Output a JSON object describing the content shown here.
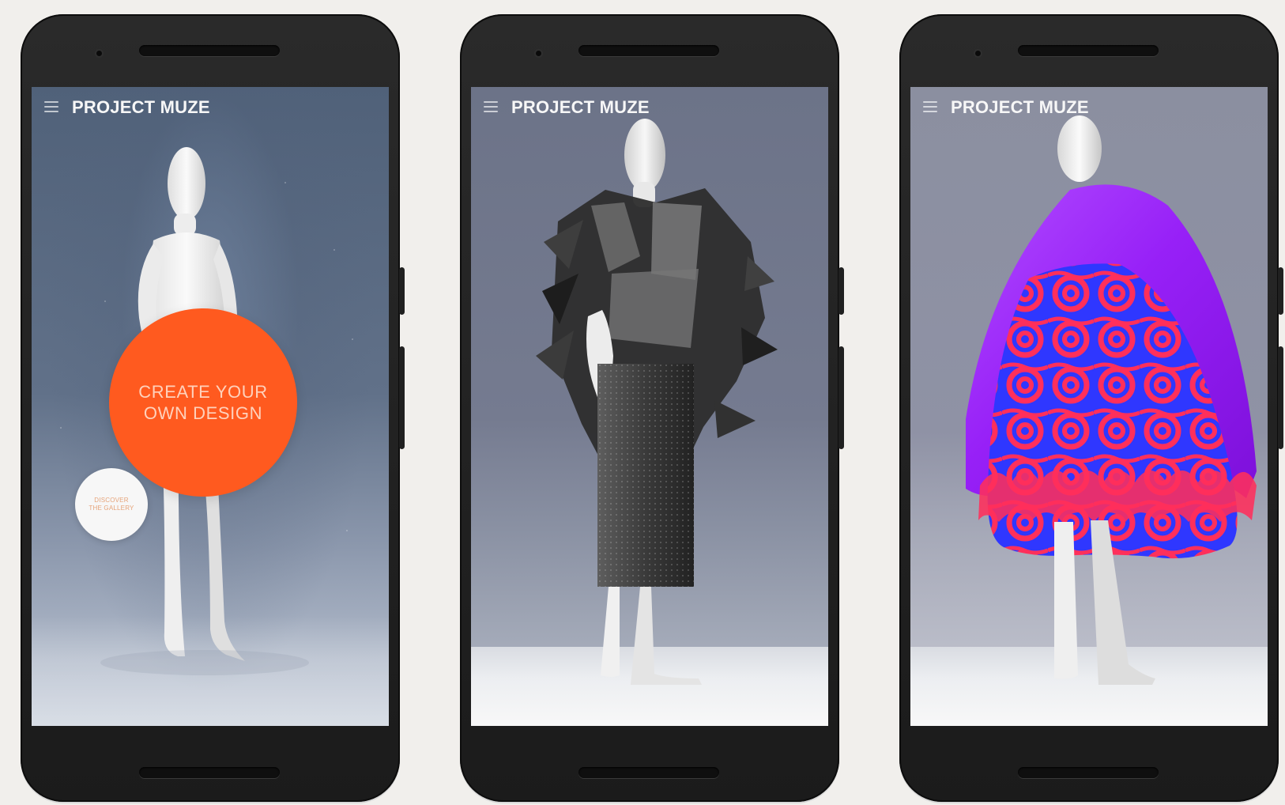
{
  "app": {
    "title": "PROJECT MUZE"
  },
  "screens": [
    {
      "title": "PROJECT MUZE",
      "cta": {
        "label": "CREATE YOUR\nOWN DESIGN"
      },
      "gallery": {
        "label": "DISCOVER\nTHE GALLERY"
      },
      "colors": {
        "background": "#61708a",
        "accent": "#ff5a1f"
      }
    },
    {
      "title": "PROJECT MUZE",
      "colors": {
        "background": "#6f7589",
        "garment": "#4d4d4d"
      }
    },
    {
      "title": "PROJECT MUZE",
      "colors": {
        "background": "#8f92a5",
        "primary": "#9c26ff",
        "pattern_red": "#ff2f5b",
        "pattern_blue": "#2f37ff"
      }
    }
  ],
  "icons": {
    "menu": "menu-icon"
  }
}
